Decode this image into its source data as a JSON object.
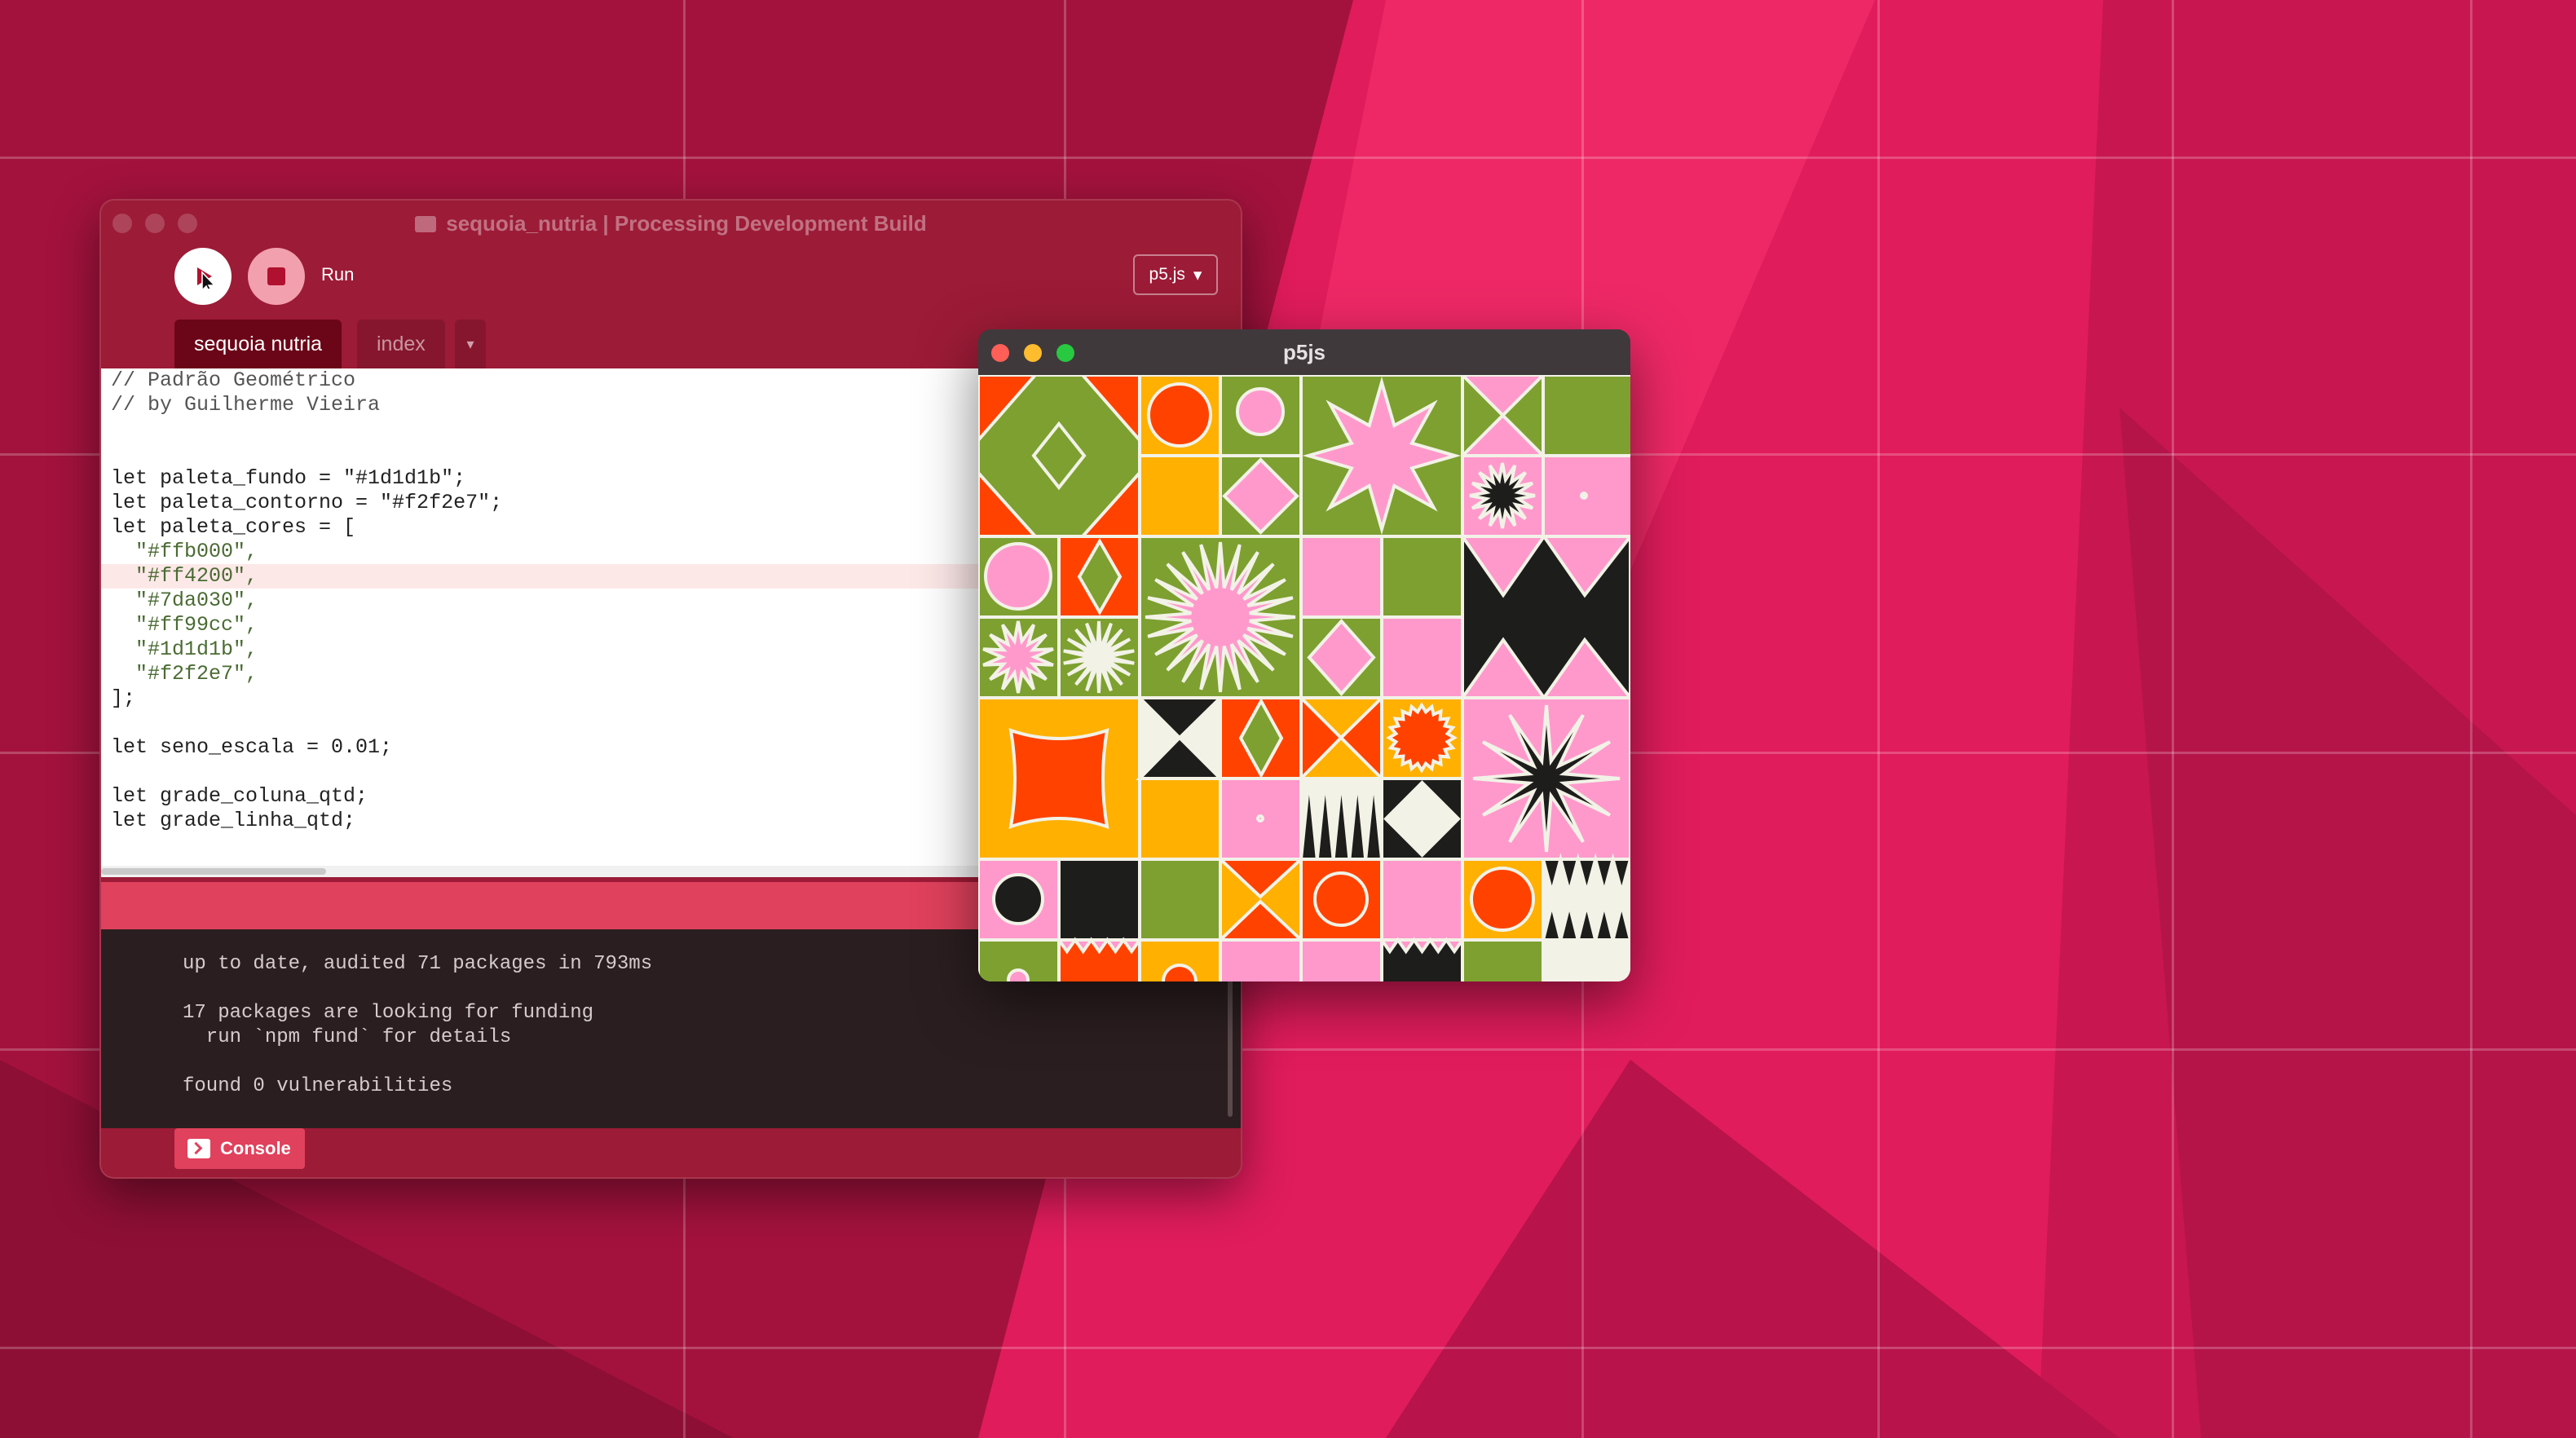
{
  "ide": {
    "window_title": "sequoia_nutria | Processing Development Build",
    "run_label": "Run",
    "mode_label": "p5.js",
    "tabs": [
      "sequoia nutria",
      "index"
    ],
    "tab_more": "▾",
    "code": [
      "// Padrão Geométrico",
      "// by Guilherme Vieira",
      "",
      "",
      "let paleta_fundo = \"#1d1d1b\";",
      "let paleta_contorno = \"#f2f2e7\";",
      "let paleta_cores = [",
      "  \"#ffb000\",",
      "  \"#ff4200\",",
      "  \"#7da030\",",
      "  \"#ff99cc\",",
      "  \"#1d1d1b\",",
      "  \"#f2f2e7\",",
      "];",
      "",
      "let seno_escala = 0.01;",
      "",
      "let grade_coluna_qtd;",
      "let grade_linha_qtd;"
    ],
    "console_lines": [
      "up to date, audited 71 packages in 793ms",
      "",
      "17 packages are looking for funding",
      "  run `npm fund` for details",
      "",
      "found 0 vulnerabilities"
    ],
    "console_label": "Console"
  },
  "p5": {
    "window_title": "p5js"
  },
  "colors": {
    "yellow": "#ffb000",
    "red": "#ff4200",
    "green": "#7da030",
    "pink": "#ff99cc",
    "black": "#1d1d1b",
    "cream": "#f2f2e7"
  }
}
